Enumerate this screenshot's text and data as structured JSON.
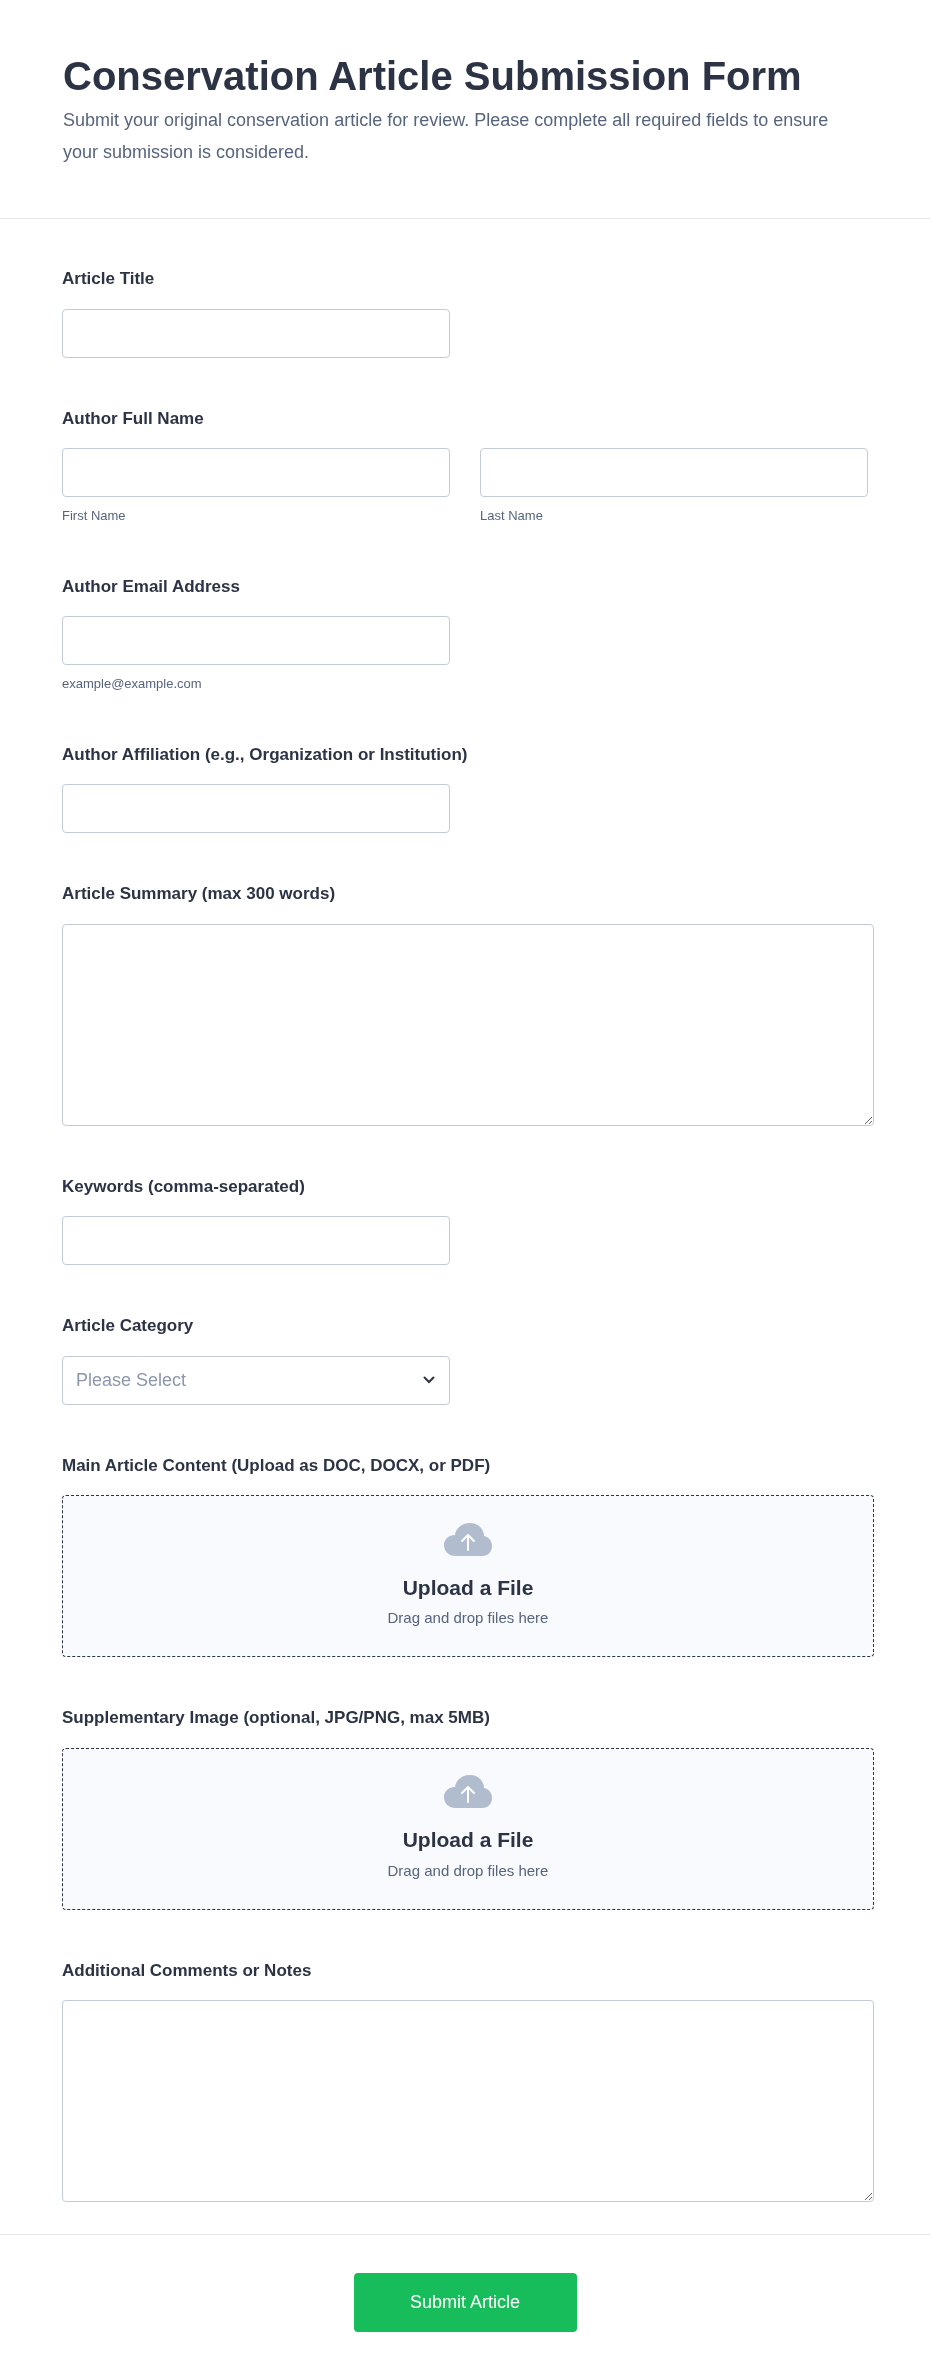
{
  "header": {
    "title": "Conservation Article Submission Form",
    "description": "Submit your original conservation article for review. Please complete all required fields to ensure your submission is considered."
  },
  "fields": [
    {
      "kind": "text",
      "label": "Article Title"
    },
    {
      "kind": "name",
      "label": "Author Full Name",
      "parts": [
        {
          "sublabel": "First Name"
        },
        {
          "sublabel": "Last Name"
        }
      ]
    },
    {
      "kind": "text",
      "label": "Author Email Address",
      "sublabel": "example@example.com"
    },
    {
      "kind": "text",
      "label": "Author Affiliation (e.g., Organization or Institution)"
    },
    {
      "kind": "textarea",
      "label": "Article Summary (max 300 words)"
    },
    {
      "kind": "text",
      "label": "Keywords (comma-separated)"
    },
    {
      "kind": "select",
      "label": "Article Category",
      "placeholder": "Please Select"
    },
    {
      "kind": "upload",
      "label": "Main Article Content (Upload as DOC, DOCX, or PDF)",
      "title": "Upload a File",
      "hint": "Drag and drop files here"
    },
    {
      "kind": "upload",
      "label": "Supplementary Image (optional, JPG/PNG, max 5MB)",
      "title": "Upload a File",
      "hint": "Drag and drop files here"
    },
    {
      "kind": "textarea",
      "label": "Additional Comments or Notes"
    }
  ],
  "submit": "Submit Article"
}
